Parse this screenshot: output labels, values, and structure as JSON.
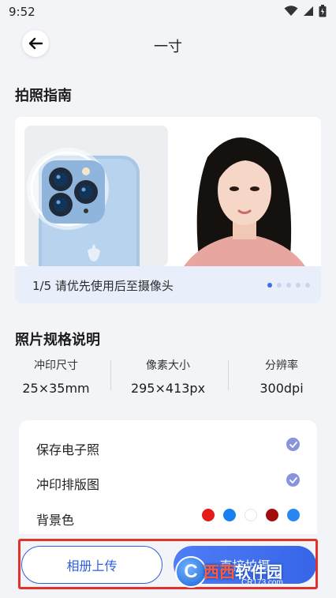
{
  "status": {
    "time": "9:52"
  },
  "header": {
    "title": "一寸"
  },
  "guide": {
    "section_title": "拍照指南",
    "caption": "1/5 请优先使用后至摄像头",
    "dots_total": 5,
    "dots_active_index": 0
  },
  "specs": {
    "section_title": "照片规格说明",
    "items": [
      {
        "label": "冲印尺寸",
        "value": "25×35mm"
      },
      {
        "label": "像素大小",
        "value": "295×413px"
      },
      {
        "label": "分辨率",
        "value": "300dpi"
      }
    ]
  },
  "options": {
    "save_electronic": {
      "label": "保存电子照",
      "checked": true
    },
    "print_layout": {
      "label": "冲印排版图",
      "checked": true
    },
    "background": {
      "label": "背景色",
      "colors": [
        "#e41b1b",
        "#1a7ff0",
        "#ffffff",
        "#a30c0c",
        "#2a86f2"
      ]
    }
  },
  "actions": {
    "upload_label": "相册上传",
    "shoot_label": "直接拍摄"
  },
  "watermark": {
    "badge": "C",
    "text_part1": "西西",
    "text_part2": "软件园",
    "url": "CR173.com"
  },
  "colors": {
    "accent": "#3a6df0",
    "highlight": "#e2322b"
  }
}
